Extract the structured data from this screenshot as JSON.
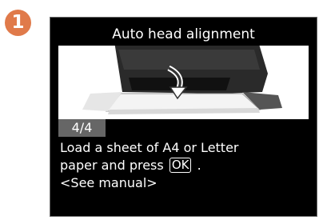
{
  "step": {
    "number": "1",
    "color": "#e07a4a"
  },
  "screen": {
    "title": "Auto head alignment",
    "page_indicator": "4/4",
    "message": {
      "line1": "Load a sheet of A4 or Letter",
      "line2_before": "paper and press",
      "ok_key": "OK",
      "line2_after": ".",
      "line3": "<See manual>"
    },
    "illustration_icon": "printer-paper-load-icon"
  },
  "colors": {
    "screen_background": "#000000",
    "text": "#ffffff",
    "page_indicator_bg": "#666666"
  }
}
